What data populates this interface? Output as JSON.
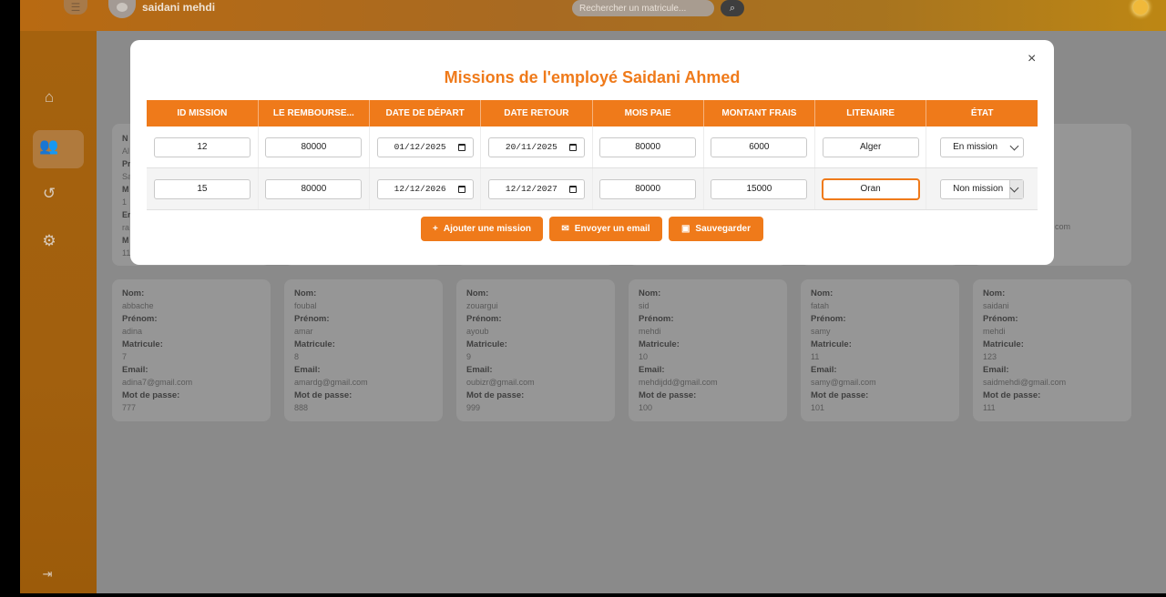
{
  "topbar": {
    "username": "saidani mehdi",
    "search_placeholder": "Rechercher un matricule..."
  },
  "modal": {
    "title": "Missions de l'employé Saidani Ahmed",
    "close": "×",
    "columns": [
      "ID MISSION",
      "LE REMBOURSE...",
      "DATE DE DÉPART",
      "DATE RETOUR",
      "MOIS PAIE",
      "MONTANT FRAIS",
      "LITENAIRE",
      "ÉTAT"
    ],
    "rows": [
      {
        "id": "12",
        "remboursement": "80000",
        "depart": "01/12/2025",
        "retour": "20/11/2025",
        "mois_paie": "80000",
        "montant_frais": "6000",
        "itineraire": "Alger",
        "etat": "En mission"
      },
      {
        "id": "15",
        "remboursement": "80000",
        "depart": "12/12/2026",
        "retour": "12/12/2027",
        "mois_paie": "80000",
        "montant_frais": "15000",
        "itineraire": "Oran",
        "etat": "Non mission"
      }
    ],
    "buttons": {
      "add": "Ajouter une mission",
      "email": "Envoyer un email",
      "save": "Sauvegarder"
    }
  },
  "cards_row1_partial": {
    "first": {
      "l1": "N",
      "l2": "Al",
      "l3": "Pr",
      "l4": "Sa",
      "l5": "M",
      "l6": "1",
      "l7": "Er",
      "l8": "ra",
      "l9": "M",
      "l10": "11"
    },
    "last_email_tail": "com"
  },
  "cards": [
    {
      "nom": "abbache",
      "prenom": "adina",
      "matricule": "7",
      "email": "adina7@gmail.com",
      "mot_de_passe": "777"
    },
    {
      "nom": "foubal",
      "prenom": "amar",
      "matricule": "8",
      "email": "amardg@gmail.com",
      "mot_de_passe": "888"
    },
    {
      "nom": "zouargui",
      "prenom": "ayoub",
      "matricule": "9",
      "email": "oubizr@gmail.com",
      "mot_de_passe": "999"
    },
    {
      "nom": "sid",
      "prenom": "mehdi",
      "matricule": "10",
      "email": "mehdijdd@gmail.com",
      "mot_de_passe": "100"
    },
    {
      "nom": "fatah",
      "prenom": "samy",
      "matricule": "11",
      "email": "samy@gmail.com",
      "mot_de_passe": "101"
    },
    {
      "nom": "saidani",
      "prenom": "mehdi",
      "matricule": "123",
      "email": "saidmehdi@gmail.com",
      "mot_de_passe": "111"
    }
  ],
  "card_labels": {
    "nom": "Nom:",
    "prenom": "Prénom:",
    "matricule": "Matricule:",
    "email": "Email:",
    "mot_de_passe": "Mot de passe:"
  },
  "colors": {
    "accent": "#ef7a1a",
    "sidebar": "#a5620e"
  }
}
